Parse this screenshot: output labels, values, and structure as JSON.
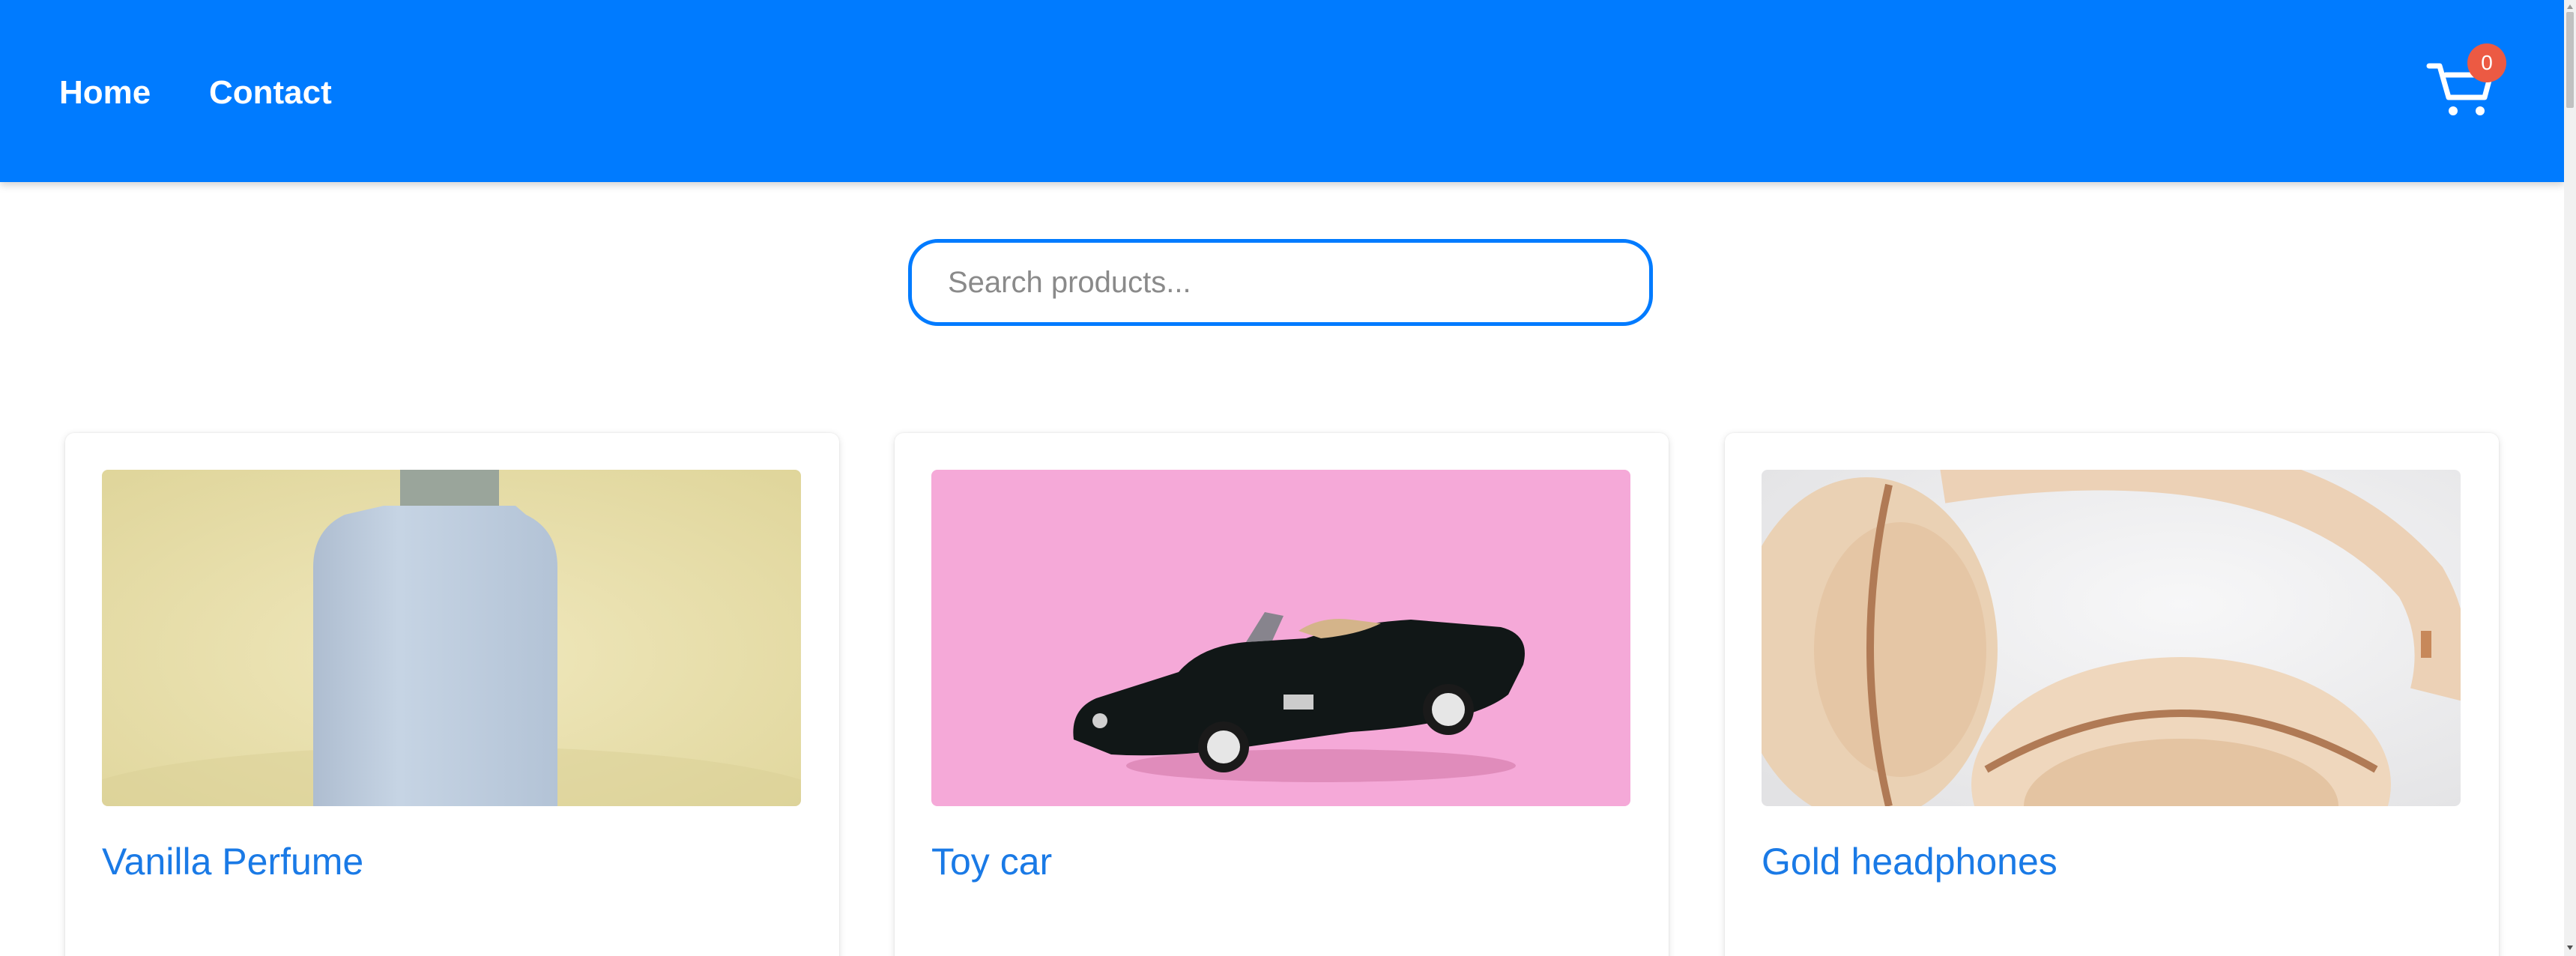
{
  "nav": {
    "links": [
      {
        "label": "Home"
      },
      {
        "label": "Contact"
      }
    ],
    "cart": {
      "count": "0",
      "icon": "cart-icon",
      "badge_color": "#ec5a43"
    },
    "background_color": "#007bff"
  },
  "search": {
    "placeholder": "Search products...",
    "value": ""
  },
  "products": [
    {
      "title": "Vanilla Perfume",
      "image": "perfume-bottle-photo"
    },
    {
      "title": "Toy car",
      "image": "toy-car-photo"
    },
    {
      "title": "Gold headphones",
      "image": "headphones-photo"
    }
  ],
  "colors": {
    "accent": "#007bff",
    "title": "#1a7ae6"
  }
}
